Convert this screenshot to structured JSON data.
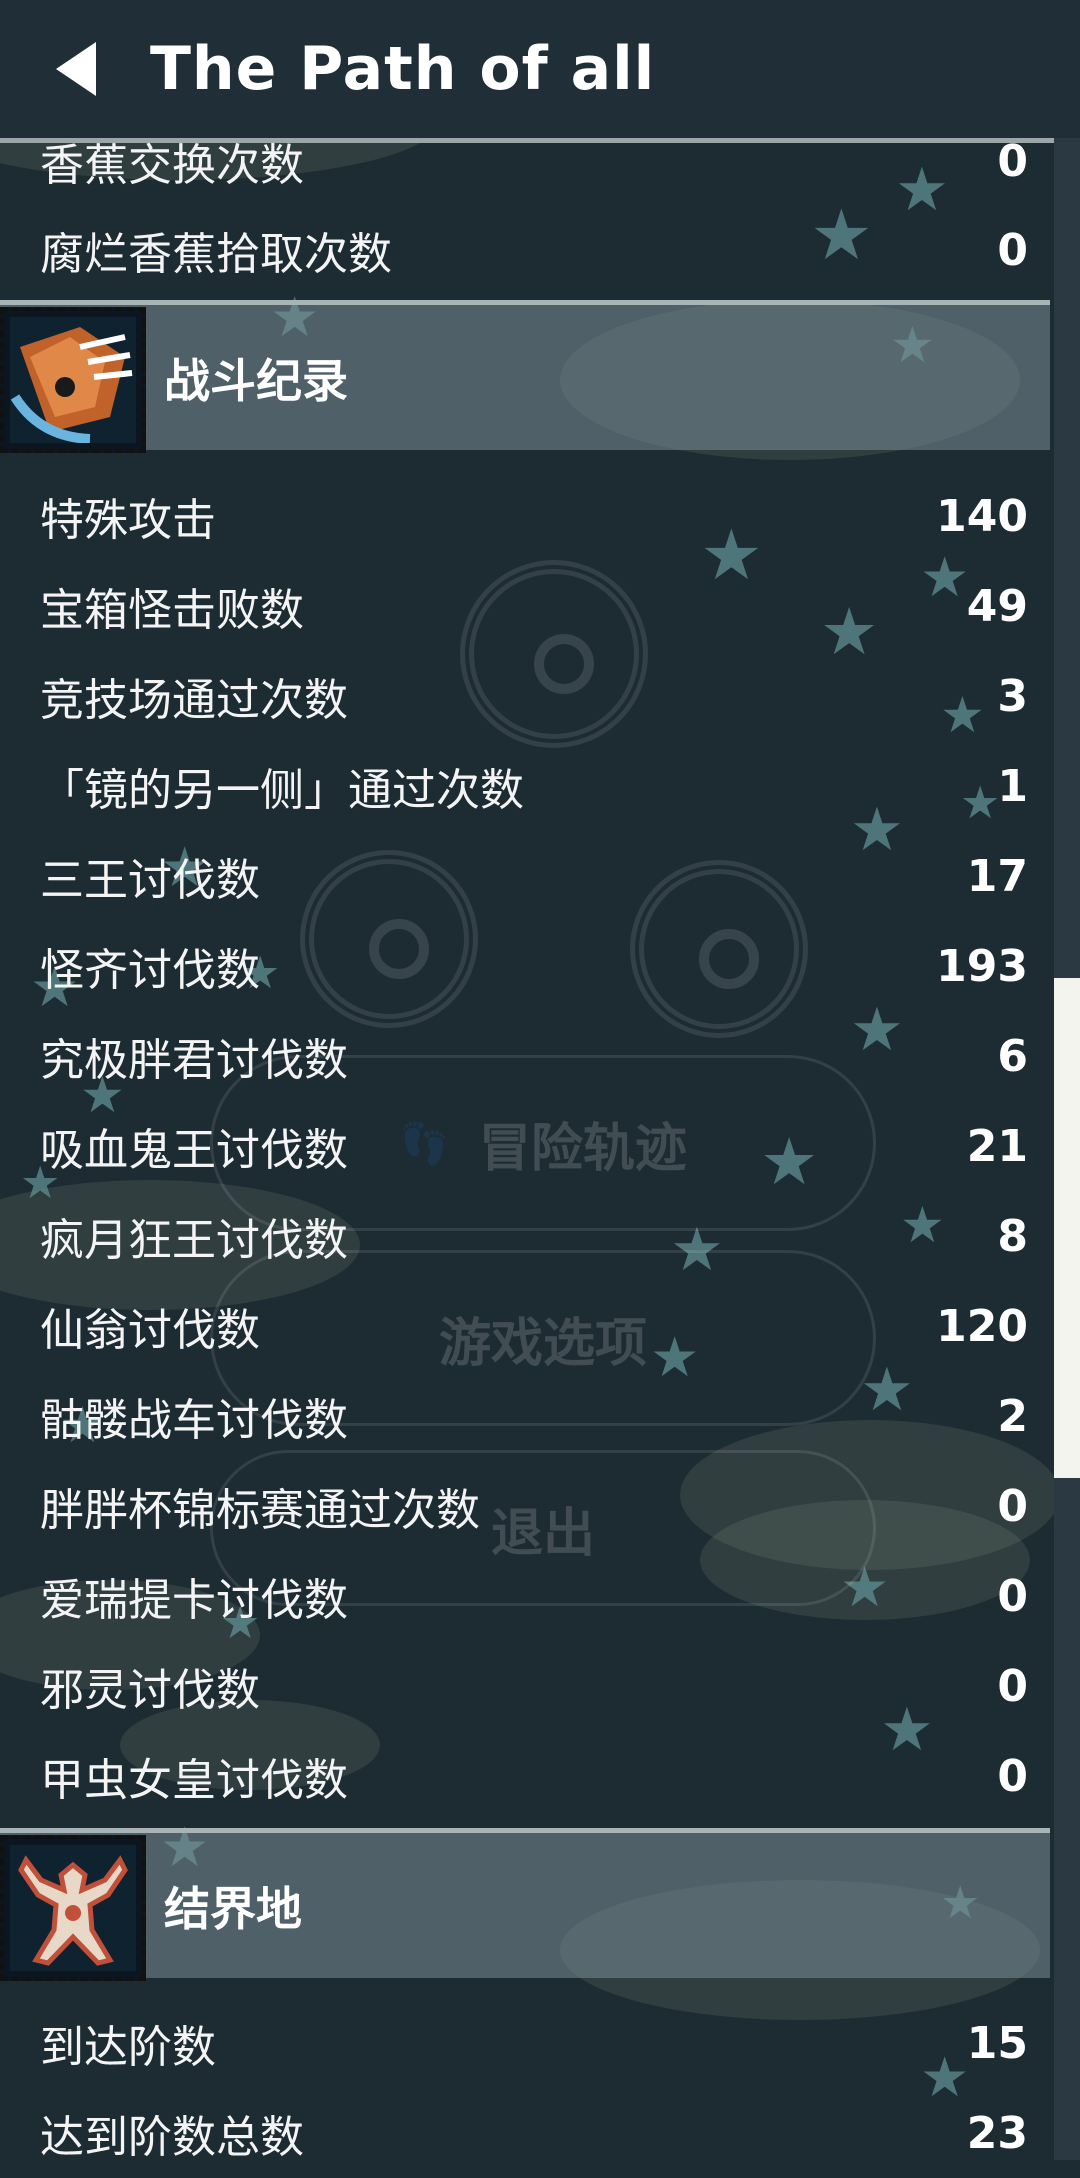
{
  "header": {
    "title": "The Path of all",
    "back_icon": "back-arrow-icon"
  },
  "menu_ghost": {
    "item1": "冒险轨迹",
    "item2": "游戏选项",
    "item3": "退出"
  },
  "top_rows": [
    {
      "label": "香蕉交换次数",
      "value": "0"
    },
    {
      "label": "腐烂香蕉拾取次数",
      "value": "0"
    }
  ],
  "battle": {
    "title": "战斗纪录",
    "icon": "claw-attack-icon",
    "rows": [
      {
        "label": "特殊攻击",
        "value": "140"
      },
      {
        "label": "宝箱怪击败数",
        "value": "49"
      },
      {
        "label": "竞技场通过次数",
        "value": "3"
      },
      {
        "label": "「镜的另一侧」通过次数",
        "value": "1"
      },
      {
        "label": "三王讨伐数",
        "value": "17"
      },
      {
        "label": "怪齐讨伐数",
        "value": "193"
      },
      {
        "label": "究极胖君讨伐数",
        "value": "6"
      },
      {
        "label": "吸血鬼王讨伐数",
        "value": "21"
      },
      {
        "label": "疯月狂王讨伐数",
        "value": "8"
      },
      {
        "label": "仙翁讨伐数",
        "value": "120"
      },
      {
        "label": "骷髅战车讨伐数",
        "value": "2"
      },
      {
        "label": "胖胖杯锦标赛通过次数",
        "value": "0"
      },
      {
        "label": "爱瑞提卡讨伐数",
        "value": "0"
      },
      {
        "label": "邪灵讨伐数",
        "value": "0"
      },
      {
        "label": "甲虫女皇讨伐数",
        "value": "0"
      }
    ]
  },
  "realm": {
    "title": "结界地",
    "icon": "figure-icon",
    "rows": [
      {
        "label": "到达阶数",
        "value": "15"
      },
      {
        "label": "达到阶数总数",
        "value": "23"
      }
    ]
  },
  "colors": {
    "background": "#1d2b33",
    "section_band": "#78909a",
    "star": "#5f8e91"
  }
}
